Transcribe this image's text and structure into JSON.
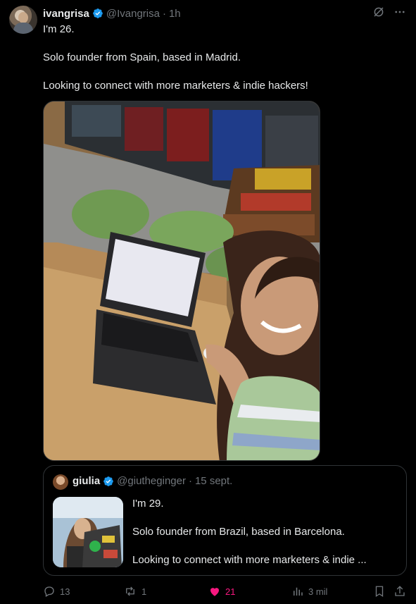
{
  "author": {
    "name": "ivangrisa",
    "handle": "@Ivangrisa",
    "separator": "·",
    "time": "1h"
  },
  "tweet": {
    "lines": [
      "I'm 26.",
      "Solo founder from Spain, based in Madrid.",
      "Looking to connect with more marketers & indie hackers!"
    ]
  },
  "quoted": {
    "name": "giulia",
    "handle": "@giutheginger",
    "separator": "·",
    "date": "15 sept.",
    "lines": [
      "I'm 29.",
      "Solo founder from Brazil, based in Barcelona.",
      "Looking to connect with more marketers & indie ..."
    ]
  },
  "actions": {
    "replies": "13",
    "reposts": "1",
    "likes": "21",
    "views": "3 mil"
  },
  "icons": [
    "verified-badge-icon",
    "grok-icon",
    "more-icon",
    "reply-icon",
    "repost-icon",
    "heart-icon",
    "views-icon",
    "bookmark-icon",
    "share-icon"
  ],
  "colors": {
    "background": "#000000",
    "text": "#e7e9ea",
    "muted": "#71767b",
    "verified": "#1d9bf0",
    "like": "#f91880"
  }
}
